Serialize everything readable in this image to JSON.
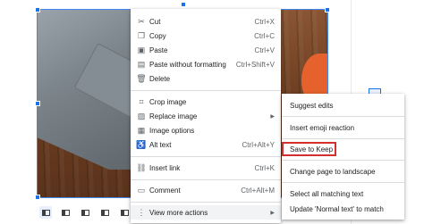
{
  "context_menu": {
    "items": [
      {
        "label": "Cut",
        "shortcut": "Ctrl+X",
        "icon": "scissors-icon"
      },
      {
        "label": "Copy",
        "shortcut": "Ctrl+C",
        "icon": "copy-icon"
      },
      {
        "label": "Paste",
        "shortcut": "Ctrl+V",
        "icon": "paste-icon"
      },
      {
        "label": "Paste without formatting",
        "shortcut": "Ctrl+Shift+V",
        "icon": "paste-plain-icon"
      },
      {
        "label": "Delete",
        "shortcut": "",
        "icon": "trash-icon"
      },
      {
        "label": "Crop image",
        "shortcut": "",
        "icon": "crop-icon"
      },
      {
        "label": "Replace image",
        "shortcut": "",
        "icon": "replace-image-icon"
      },
      {
        "label": "Image options",
        "shortcut": "",
        "icon": "image-options-icon"
      },
      {
        "label": "Alt text",
        "shortcut": "Ctrl+Alt+Y",
        "icon": "alt-text-icon"
      },
      {
        "label": "Insert link",
        "shortcut": "Ctrl+K",
        "icon": "link-icon"
      },
      {
        "label": "Comment",
        "shortcut": "Ctrl+Alt+M",
        "icon": "comment-icon"
      },
      {
        "label": "View more actions",
        "shortcut": "",
        "icon": "more-vert-icon"
      }
    ]
  },
  "sub_menu": {
    "items": [
      {
        "label": "Suggest edits"
      },
      {
        "label": "Insert emoji reaction"
      },
      {
        "label": "Save to Keep"
      },
      {
        "label": "Change page to landscape"
      },
      {
        "label": "Select all matching text"
      },
      {
        "label": "Update 'Normal text' to match"
      }
    ],
    "highlighted": "Save to Keep"
  },
  "image_toolbar": {
    "buttons": [
      "inline-icon",
      "wrap-text-icon",
      "break-text-icon",
      "behind-text-icon",
      "in-front-of-text-icon",
      "more-options-icon"
    ],
    "more_glyph": "⋮"
  },
  "colors": {
    "selection": "#4285f4",
    "highlight_box": "#d32f2f",
    "menu_bg": "#ffffff"
  }
}
